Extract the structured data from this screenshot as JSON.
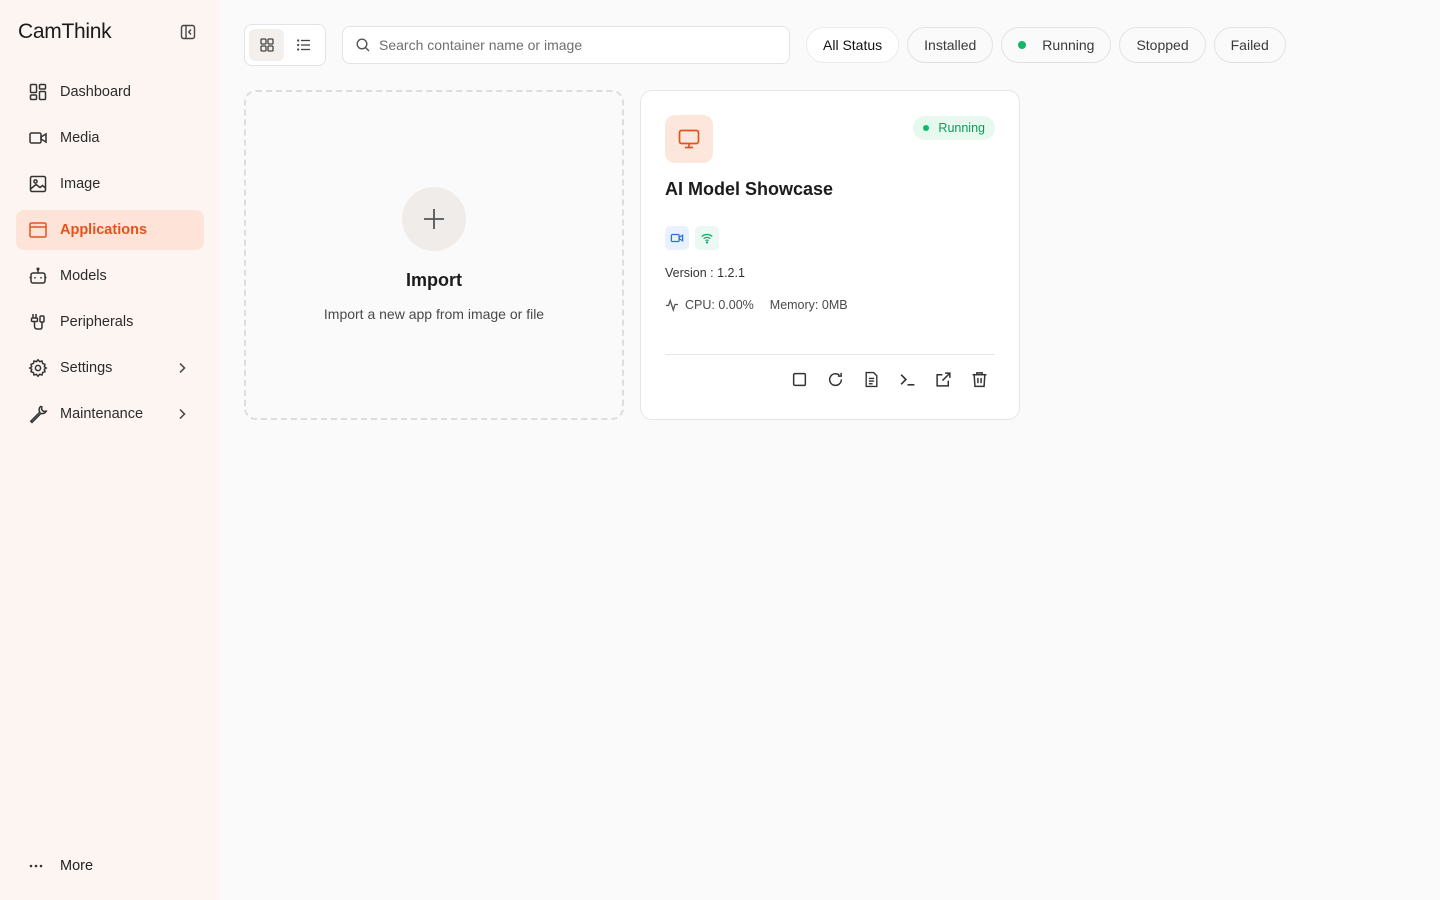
{
  "brand": {
    "name_part1": "Cam",
    "name_part2": "Think"
  },
  "sidebar": {
    "items": [
      {
        "label": "Dashboard",
        "icon": "dashboard-icon"
      },
      {
        "label": "Media",
        "icon": "video-camera-icon"
      },
      {
        "label": "Image",
        "icon": "image-icon"
      },
      {
        "label": "Applications",
        "icon": "app-window-icon",
        "active": true
      },
      {
        "label": "Models",
        "icon": "robot-icon"
      },
      {
        "label": "Peripherals",
        "icon": "peripherals-icon"
      },
      {
        "label": "Settings",
        "icon": "gear-icon",
        "expandable": true
      },
      {
        "label": "Maintenance",
        "icon": "wrench-icon",
        "expandable": true
      }
    ],
    "more_label": "More"
  },
  "toolbar": {
    "search_placeholder": "Search container name or image",
    "filters": [
      "All Status",
      "Installed",
      "Running",
      "Stopped",
      "Failed"
    ],
    "active_filter": "All Status"
  },
  "import_card": {
    "title": "Import",
    "subtitle": "Import a new app from image or file"
  },
  "app_card": {
    "title": "AI Model Showcase",
    "status": "Running",
    "version": "Version : 1.2.1",
    "cpu": "CPU: 0.00%",
    "memory": "Memory: 0MB",
    "capabilities": [
      "video-camera-icon",
      "wifi-icon"
    ],
    "actions": [
      "stop-icon",
      "restart-icon",
      "logs-icon",
      "terminal-icon",
      "open-external-icon",
      "delete-icon"
    ]
  },
  "colors": {
    "accent": "#e4531b",
    "active_bg": "#fde3d8",
    "sidebar_bg": "#fdf5f2",
    "running_green": "#12b76a"
  }
}
